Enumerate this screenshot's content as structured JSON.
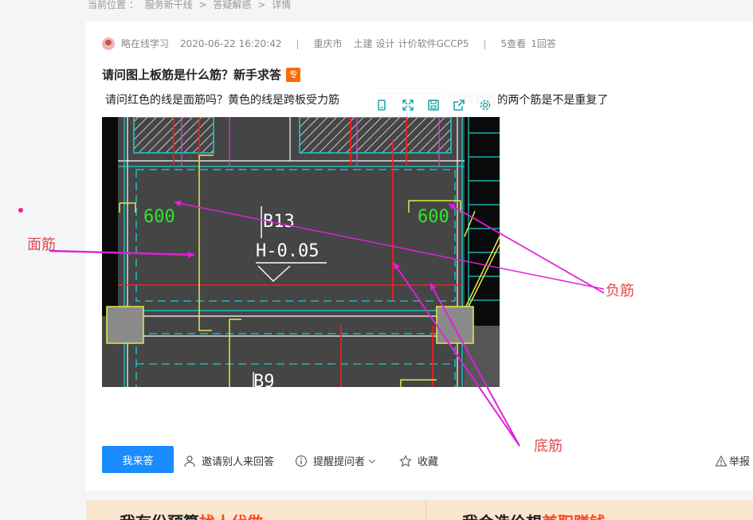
{
  "breadcrumb": {
    "label": "当前位置 ：",
    "items": [
      "服务新干线",
      "答疑解惑",
      "详情"
    ],
    "separator": ">"
  },
  "question": {
    "author": "略在线学习",
    "datetime": "2020-06-22 16:20:42",
    "separator": "|",
    "location": "重庆市",
    "tags": [
      "土建",
      "设计",
      "计价软件GCCP5"
    ],
    "views": "5查看",
    "answers": "1回答",
    "title": "请问图上板筋是什么筋？新手求答",
    "badge": "专",
    "body_before": "请问红色的线是面筋吗？黄色的线是跨板受力筋",
    "body_after": "?这样垂直的两个筋是不是重复了"
  },
  "drawing": {
    "left_label": "600",
    "right_label": "600",
    "slab_name": "B13",
    "slab_elev": "H-0.05",
    "lower_slab": "B9"
  },
  "annotations": {
    "top_rebar": "面筋",
    "negative_rebar": "负筋",
    "bottom_rebar": "底筋"
  },
  "actions": {
    "answer": "我来答",
    "invite": "邀请别人来回答",
    "remind": "提醒提问者",
    "favorite": "收藏",
    "report": "举报"
  },
  "banner": {
    "left_text": "我有份预算",
    "left_highlight": "找人代做",
    "right_text": "我会造价想",
    "right_highlight": "兼职赚钱"
  },
  "colors": {
    "primary": "#1a8cff",
    "badge": "#ff6a00",
    "annotation_text": "#e34a4a",
    "arrow": "#e020d8",
    "cad_background": "#454545"
  }
}
